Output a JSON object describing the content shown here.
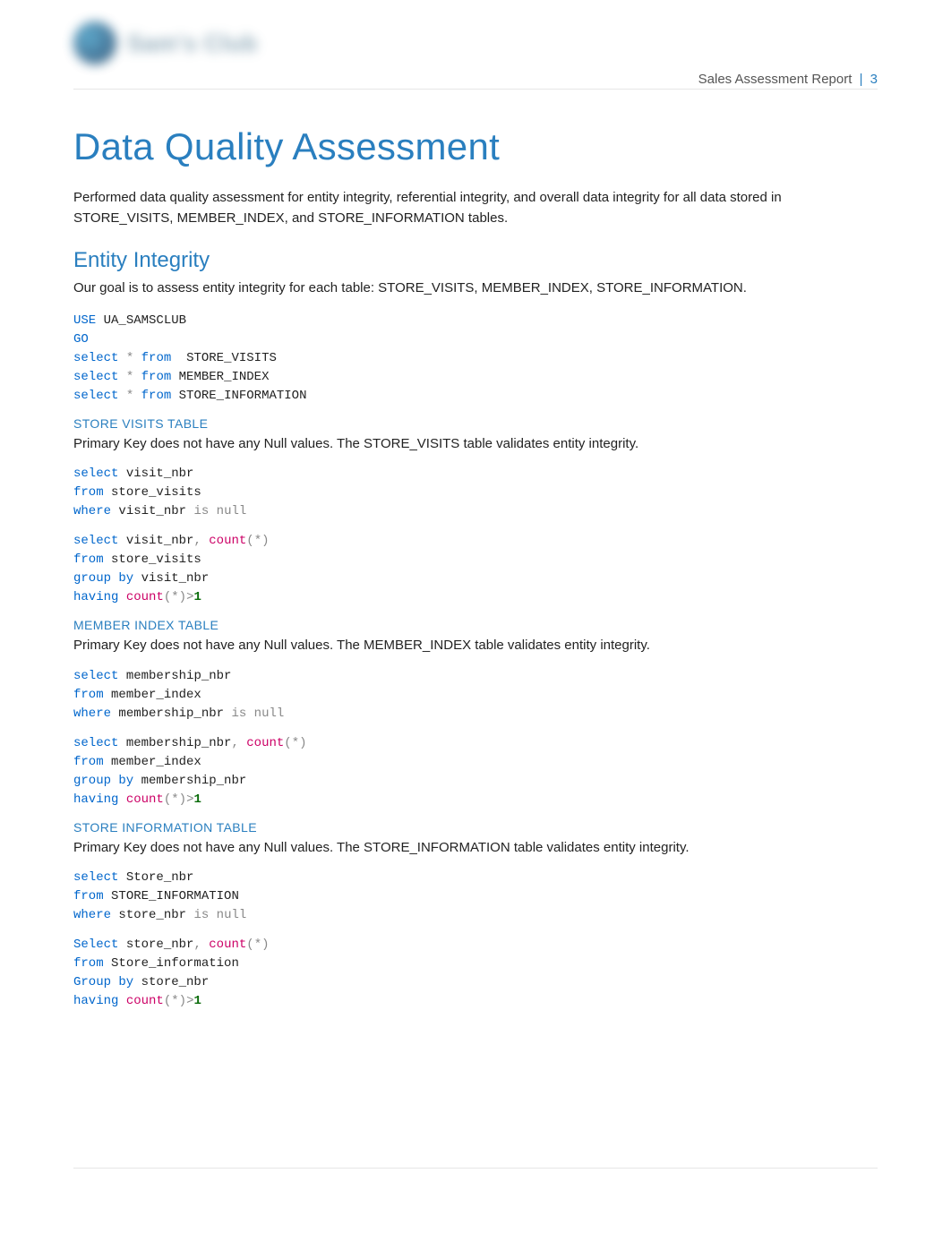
{
  "header": {
    "logo_text": "Sam's Club",
    "doc_title": "Sales Assessment Report",
    "separator": "|",
    "page_number": "3"
  },
  "title": "Data Quality Assessment",
  "intro": "Performed data quality assessment for entity integrity, referential integrity, and overall data integrity for all data stored in STORE_VISITS, MEMBER_INDEX, and STORE_INFORMATION tables.",
  "entity_integrity": {
    "heading": "Entity Integrity",
    "goal": "Our goal is to assess entity integrity for each table: STORE_VISITS, MEMBER_INDEX, STORE_INFORMATION.",
    "code_top": {
      "kw_use": "USE",
      "db": "UA_SAMSCLUB",
      "kw_go": "GO",
      "kw_select1": "select",
      "star1": "*",
      "kw_from1": "from",
      "tbl1": "STORE_VISITS",
      "kw_select2": "select",
      "star2": "*",
      "kw_from2": "from",
      "tbl2": "MEMBER_INDEX",
      "kw_select3": "select",
      "star3": "*",
      "kw_from3": "from",
      "tbl3": "STORE_INFORMATION"
    },
    "store_visits": {
      "heading": "STORE VISITS TABLE",
      "desc": "Primary Key does not have any Null values. The STORE_VISITS table validates entity integrity.",
      "c1": {
        "kw_select": "select",
        "col": "visit_nbr",
        "kw_from": "from",
        "tbl": "store_visits",
        "kw_where": "where",
        "col2": "visit_nbr",
        "kw_is": "is",
        "kw_null": "null"
      },
      "c2": {
        "kw_select": "select",
        "col": "visit_nbr",
        "comma": ",",
        "fn": "count",
        "lp": "(",
        "star": "*",
        "rp": ")",
        "kw_from": "from",
        "tbl": "store_visits",
        "kw_group": "group by",
        "col2": "visit_nbr",
        "kw_having": "having",
        "fn2": "count",
        "lp2": "(",
        "star2": "*",
        "rp2": ")",
        "gt": ">",
        "one": "1"
      }
    },
    "member_index": {
      "heading": "MEMBER INDEX TABLE",
      "desc": "Primary Key does not have any Null values. The MEMBER_INDEX table validates entity integrity.",
      "c1": {
        "kw_select": "select",
        "col": "membership_nbr",
        "kw_from": "from",
        "tbl": "member_index",
        "kw_where": "where",
        "col2": "membership_nbr",
        "kw_is": "is",
        "kw_null": "null"
      },
      "c2": {
        "kw_select": "select",
        "col": "membership_nbr",
        "comma": ",",
        "fn": "count",
        "lp": "(",
        "star": "*",
        "rp": ")",
        "kw_from": "from",
        "tbl": "member_index",
        "kw_group": "group by",
        "col2": "membership_nbr",
        "kw_having": "having",
        "fn2": "count",
        "lp2": "(",
        "star2": "*",
        "rp2": ")",
        "gt": ">",
        "one": "1"
      }
    },
    "store_information": {
      "heading": "STORE INFORMATION TABLE",
      "desc": "Primary Key does not have any Null values. The STORE_INFORMATION table validates entity integrity.",
      "c1": {
        "kw_select": "select",
        "col": "Store_nbr",
        "kw_from": "from",
        "tbl": "STORE_INFORMATION",
        "kw_where": "where",
        "col2": "store_nbr",
        "kw_is": "is",
        "kw_null": "null"
      },
      "c2": {
        "kw_select": "Select",
        "col": "store_nbr",
        "comma": ",",
        "fn": "count",
        "lp": "(",
        "star": "*",
        "rp": ")",
        "kw_from": "from",
        "tbl": "Store_information",
        "kw_group": "Group by",
        "col2": "store_nbr",
        "kw_having": "having",
        "fn2": "count",
        "lp2": "(",
        "star2": "*",
        "rp2": ")",
        "gt": ">",
        "one": "1"
      }
    }
  }
}
